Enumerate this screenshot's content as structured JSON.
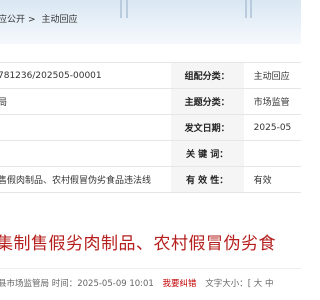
{
  "breadcrumb": {
    "item1": "应公开",
    "sep": ">",
    "item2": "主动回应"
  },
  "meta": [
    {
      "left": "781236/202505-00001",
      "label": "组配分类：",
      "right": "主动回应"
    },
    {
      "left": "局",
      "label": "主题分类：",
      "right": "市场监管"
    },
    {
      "left": "",
      "label": "发文日期：",
      "right": "2025-05"
    },
    {
      "left": "",
      "label": "关 键 词：",
      "right": ""
    },
    {
      "left": "售假肉制品、农村假冒伪劣食品违法线",
      "label": "有 效 性：",
      "right": "有效"
    }
  ],
  "title": "集制售假劣肉制品、农村假冒伪劣食",
  "info": {
    "source": "县市场监管局",
    "time_label": "时间：",
    "time": "2025-05-09 10:01",
    "report": "我要纠错",
    "font_label": "文字大小：[ 大",
    "font_end": "中"
  },
  "colors": {
    "title": "#b5201e",
    "label_bg": "#f5f5f5",
    "banner": "#d9e7f3"
  }
}
